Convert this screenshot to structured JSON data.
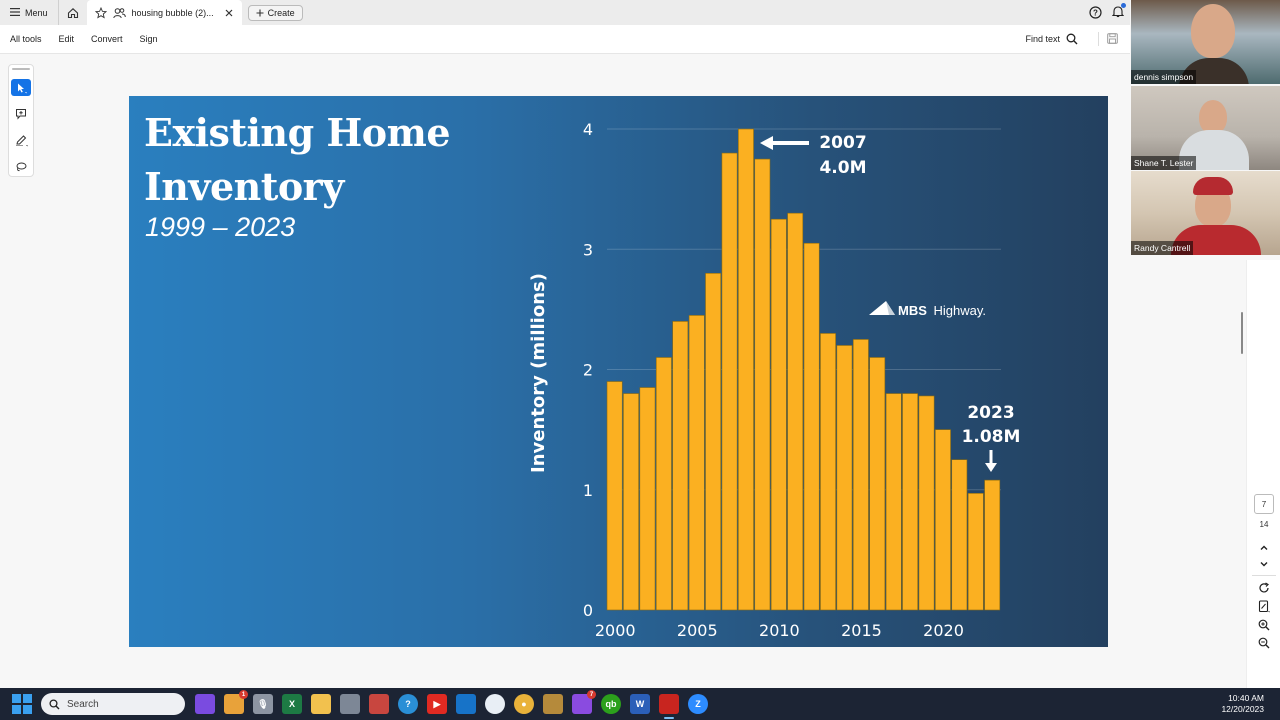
{
  "titlebar": {
    "menu_label": "Menu",
    "tab_title": "housing bubble (2)...",
    "create_label": "Create",
    "icons": [
      "hamburger-icon",
      "home-icon",
      "star-icon",
      "shared-users-icon",
      "close-icon",
      "plus-icon",
      "help-icon",
      "bell-icon"
    ]
  },
  "toolbar": {
    "items": [
      {
        "label": "All tools"
      },
      {
        "label": "Edit"
      },
      {
        "label": "Convert"
      },
      {
        "label": "Sign"
      }
    ],
    "find_label": "Find text"
  },
  "tool_rail": {
    "tools": [
      "select-tool",
      "add-comment-tool",
      "draw-tool",
      "lasso-tool"
    ],
    "active": "select-tool"
  },
  "slide": {
    "title_line1": "Existing Home",
    "title_line2": "Inventory",
    "subtitle": "1999 – 2023",
    "logo_text_bold": "MBS",
    "logo_text": "Highway.",
    "annotation_peak_year": "2007",
    "annotation_peak_value": "4.0M",
    "annotation_last_year": "2023",
    "annotation_last_value": "1.08M"
  },
  "chart_data": {
    "type": "bar",
    "title": "Existing Home Inventory",
    "subtitle": "1999 – 2023",
    "xlabel": "",
    "ylabel": "Inventory (millions)",
    "ylim": [
      0,
      4
    ],
    "yticks": [
      0,
      1,
      2,
      3,
      4
    ],
    "xticks": [
      "2000",
      "2005",
      "2010",
      "2015",
      "2020"
    ],
    "categories": [
      "2000",
      "2001",
      "2002",
      "2003",
      "2004",
      "2005",
      "2006",
      "2007",
      "2008",
      "2009",
      "2010",
      "2011",
      "2012",
      "2013",
      "2014",
      "2015",
      "2016",
      "2017",
      "2018",
      "2019",
      "2020",
      "2021",
      "2022",
      "2023"
    ],
    "values": [
      1.9,
      1.8,
      1.85,
      2.1,
      2.4,
      2.45,
      2.8,
      3.8,
      4.0,
      3.75,
      3.25,
      3.3,
      3.05,
      2.3,
      2.2,
      2.25,
      2.1,
      1.8,
      1.8,
      1.78,
      1.5,
      1.25,
      0.97,
      1.08
    ],
    "grid": true,
    "bar_color": "#fbb021",
    "annotations": [
      {
        "text": "2007\n4.0M",
        "points_to_index": 8
      },
      {
        "text": "2023\n1.08M",
        "points_to_index": 23
      }
    ]
  },
  "participants": [
    {
      "name": "dennis simpson"
    },
    {
      "name": "Shane T. Lester"
    },
    {
      "name": "Randy Cantrell"
    }
  ],
  "page_nav": {
    "current_page": "7",
    "total_pages": "14"
  },
  "taskbar": {
    "search_placeholder": "Search",
    "apps": [
      {
        "name": "copilot"
      },
      {
        "name": "widgets",
        "badge": "1"
      },
      {
        "name": "voice"
      },
      {
        "name": "excel"
      },
      {
        "name": "file-explorer"
      },
      {
        "name": "settings"
      },
      {
        "name": "snipping-tool"
      },
      {
        "name": "help"
      },
      {
        "name": "youtube"
      },
      {
        "name": "outlook"
      },
      {
        "name": "perplexity"
      },
      {
        "name": "chrome"
      },
      {
        "name": "app"
      },
      {
        "name": "messenger",
        "badge": "7"
      },
      {
        "name": "quickbooks"
      },
      {
        "name": "word"
      },
      {
        "name": "acrobat",
        "active": true
      },
      {
        "name": "zoom"
      }
    ],
    "time": "10:40 AM",
    "date": "12/20/2023"
  }
}
